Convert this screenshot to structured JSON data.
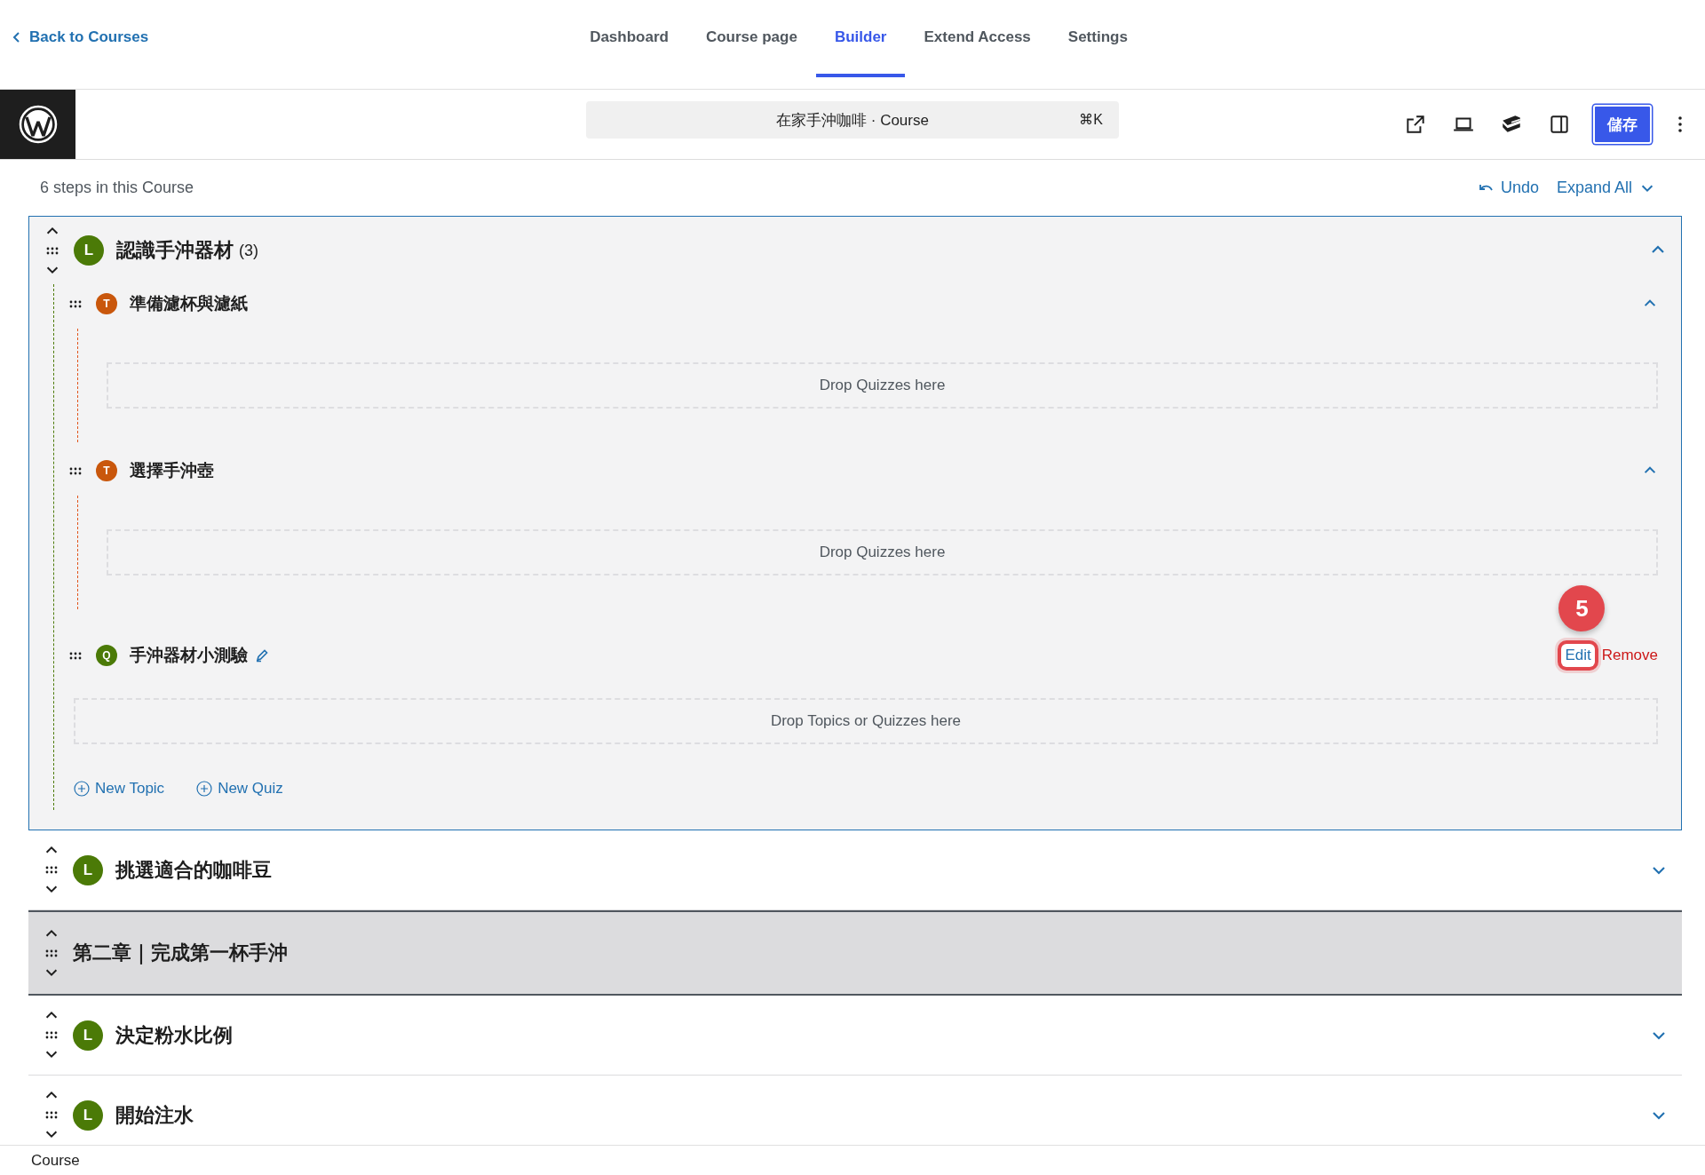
{
  "back_link": "Back to Courses",
  "tabs": [
    {
      "label": "Dashboard",
      "selected": false
    },
    {
      "label": "Course page",
      "selected": false
    },
    {
      "label": "Builder",
      "selected": true
    },
    {
      "label": "Extend Access",
      "selected": false
    },
    {
      "label": "Settings",
      "selected": false
    }
  ],
  "editor_toolbar": {
    "command_bar": "在家手沖咖啡 · Course",
    "shortcut": "⌘K",
    "save_button": "儲存"
  },
  "builder": {
    "steps_count": "6 steps in this Course",
    "undo": "Undo",
    "expand_all": "Expand All",
    "items": [
      {
        "kind": "lesson",
        "badge": "L",
        "title": "認識手沖器材",
        "count": "(3)",
        "expanded": true,
        "children": [
          {
            "kind": "topic",
            "badge": "T",
            "title": "準備濾杯與濾紙",
            "expanded": true,
            "drop_zone": "Drop Quizzes here"
          },
          {
            "kind": "topic",
            "badge": "T",
            "title": "選擇手沖壺",
            "expanded": true,
            "drop_zone": "Drop Quizzes here"
          },
          {
            "kind": "quiz",
            "badge": "Q",
            "title": "手沖器材小測驗",
            "edit": "Edit",
            "remove": "Remove",
            "step_marker": "5"
          }
        ],
        "drop_zone": "Drop Topics or Quizzes here",
        "add_buttons": [
          "New Topic",
          "New Quiz"
        ]
      },
      {
        "kind": "lesson",
        "badge": "L",
        "title": "挑選適合的咖啡豆",
        "expanded": false
      },
      {
        "kind": "section",
        "title": "第二章｜完成第一杯手沖"
      },
      {
        "kind": "lesson",
        "badge": "L",
        "title": "決定粉水比例",
        "expanded": false
      },
      {
        "kind": "lesson",
        "badge": "L",
        "title": "開始注水",
        "expanded": false
      }
    ]
  },
  "status_bar": "Course"
}
